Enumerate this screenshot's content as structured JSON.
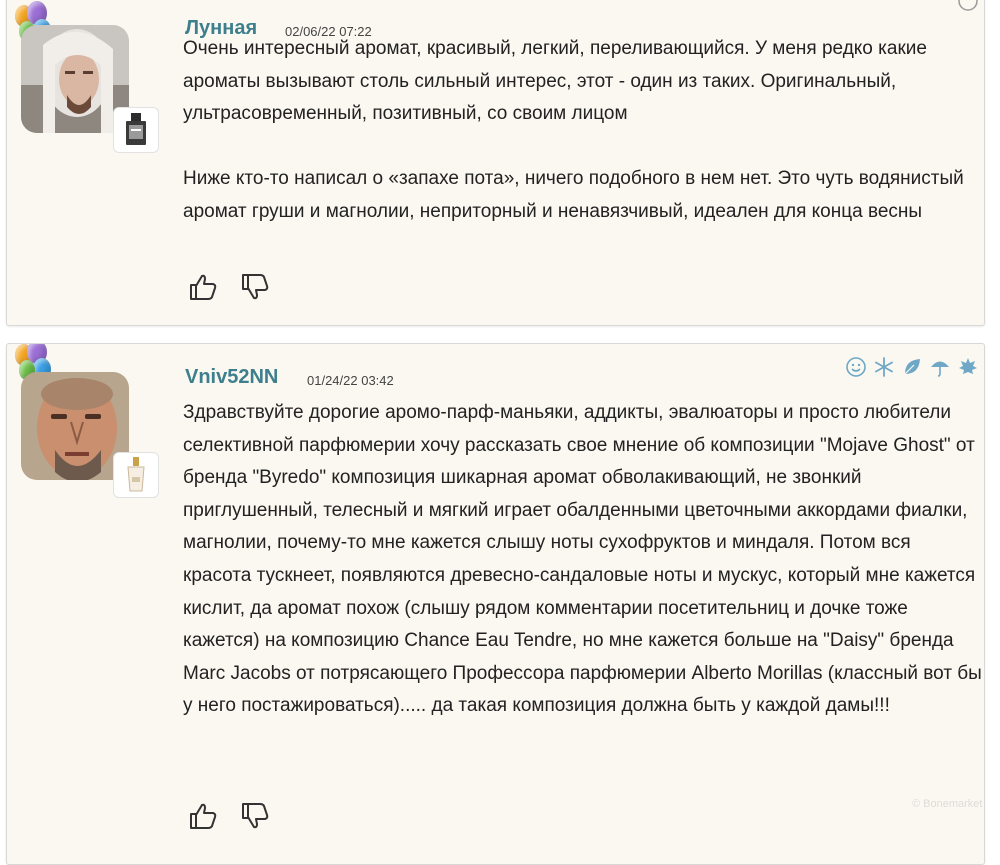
{
  "comments": [
    {
      "username": "Лунная",
      "date": "02/06/22 07:22",
      "paragraphs": [
        "Очень интересный аромат, красивый, легкий, переливающийся. У меня редко какие ароматы вызывают столь сильный интерес, этот - один из таких. Оригинальный, ультрасовременный, позитивный, со своим лицом",
        "Ниже кто-то написал о «запахе пота», ничего подобного в нем нет. Это чуть водянистый аромат груши и магнолии, неприторный и ненавязчивый, идеален для конца весны"
      ]
    },
    {
      "username": "Vniv52NN",
      "date": "01/24/22 03:42",
      "paragraphs": [
        "Здравствуйте дорогие аромо-парф-маньяки, аддикты, эвалюаторы и просто любители селективной парфюмерии хочу рассказать свое мнение об композиции \"Mojave Ghost\" от бренда \"Byredo\" композиция шикарная аромат обволакивающий, не звонкий приглушенный, телесный и мягкий играет обалденными цветочными аккордами фиалки, магнолии, почему-то мне кажется слышу ноты сухофруктов и миндаля. Потом вся красота тускнеет, появляются древесно-сандаловые ноты и мускус, который мне кажется кислит, да аромат похож (слышу рядом комментарии посетительниц и дочке тоже кажется) на композицию Chance Eau Tendre, но мне кажется больше на \"Daisy\" бренда Marc Jacobs от потрясающего Профессора парфюмерии Alberto Morillas (классный вот бы у него постажироваться)..... да такая композиция должна быть у каждой дамы!!!"
      ]
    }
  ],
  "season_icons": [
    "smile-icon",
    "snowflake-icon",
    "leaf-icon",
    "umbrella-icon",
    "maple-leaf-icon"
  ],
  "colors": {
    "username": "#3d7f8c",
    "card_bg": "#fbf8f1",
    "season_icon": "#6fa8c6"
  },
  "watermark": "© Bonemarket"
}
